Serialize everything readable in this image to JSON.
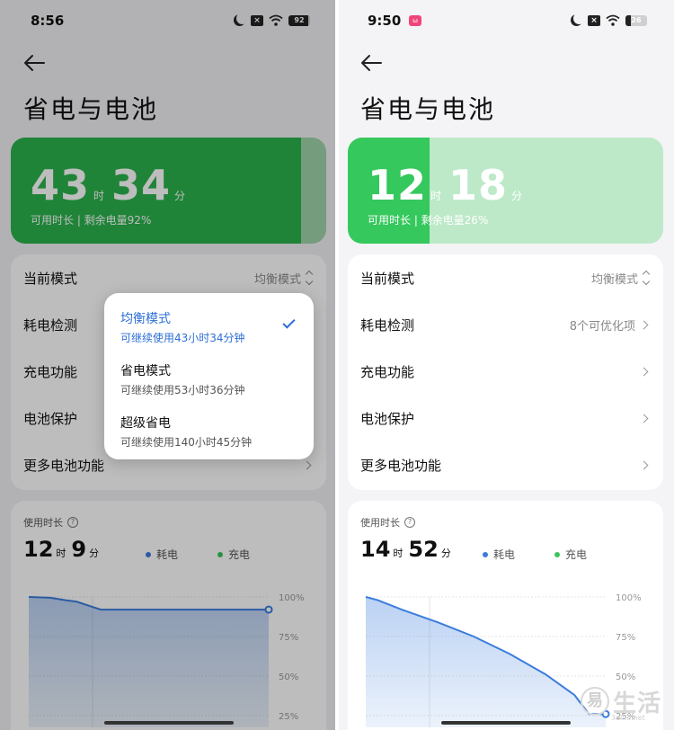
{
  "left": {
    "status": {
      "time": "8:56",
      "battery": "92",
      "battery_level": 0.92
    },
    "title": "省电与电池",
    "battery_card": {
      "hours": "43",
      "hour_unit": "时",
      "minutes": "34",
      "minute_unit": "分",
      "subtitle": "可用时长 | 剩余电量92%",
      "level": 0.92,
      "fill_color": "#2bb24c",
      "rest_color": "#9ed3a8"
    },
    "rows": [
      {
        "label": "当前模式",
        "value": "均衡模式"
      },
      {
        "label": "耗电检测",
        "value": ""
      },
      {
        "label": "充电功能",
        "value": ""
      },
      {
        "label": "电池保护",
        "value": ""
      },
      {
        "label": "更多电池功能",
        "value": ""
      }
    ],
    "usage": {
      "title": "使用时长",
      "hours": "12",
      "hour_unit": "时",
      "minutes": "9",
      "minute_unit": "分",
      "legend_drain": "耗电",
      "legend_charge": "充电"
    },
    "popup": {
      "options": [
        {
          "name": "均衡模式",
          "desc": "可继续使用43小时34分钟",
          "selected": true
        },
        {
          "name": "省电模式",
          "desc": "可继续使用53小时36分钟",
          "selected": false
        },
        {
          "name": "超级省电",
          "desc": "可继续使用140小时45分钟",
          "selected": false
        }
      ]
    }
  },
  "right": {
    "status": {
      "time": "9:50",
      "battery": "26",
      "battery_level": 0.26
    },
    "title": "省电与电池",
    "battery_card": {
      "hours": "12",
      "hour_unit": "时",
      "minutes": "18",
      "minute_unit": "分",
      "subtitle": "可用时长 | 剩余电量26%",
      "level": 0.26,
      "fill_color": "#35c85c",
      "rest_color": "#bde9c8"
    },
    "rows": [
      {
        "label": "当前模式",
        "value": "均衡模式"
      },
      {
        "label": "耗电检测",
        "value": "8个可优化项"
      },
      {
        "label": "充电功能",
        "value": ""
      },
      {
        "label": "电池保护",
        "value": ""
      },
      {
        "label": "更多电池功能",
        "value": ""
      }
    ],
    "usage": {
      "title": "使用时长",
      "hours": "14",
      "hour_unit": "时",
      "minutes": "52",
      "minute_unit": "分",
      "legend_drain": "耗电",
      "legend_charge": "充电"
    }
  },
  "colors": {
    "drain": "#3b7ddd",
    "charge": "#3cc45a",
    "accent": "#2d6fd6"
  },
  "chart_data": [
    {
      "type": "area",
      "y_ticks": [
        "100%",
        "75%",
        "50%",
        "25%"
      ],
      "ylim": [
        25,
        100
      ],
      "x": [
        0,
        0.09,
        0.15,
        0.2,
        0.26,
        0.3,
        0.45,
        0.6,
        1.0
      ],
      "values": [
        100,
        99.5,
        98,
        97,
        94,
        92,
        92,
        92,
        92
      ],
      "color": "#3b7ddd",
      "xlabel": "",
      "ylabel": "",
      "title": ""
    },
    {
      "type": "area",
      "y_ticks": [
        "100%",
        "75%",
        "50%",
        "25%"
      ],
      "ylim": [
        25,
        100
      ],
      "x": [
        0,
        0.05,
        0.15,
        0.3,
        0.45,
        0.6,
        0.75,
        0.87,
        0.93,
        1.0
      ],
      "values": [
        100,
        98,
        92,
        84,
        75,
        64,
        51,
        38,
        26,
        26
      ],
      "color": "#3b7ddd",
      "xlabel": "",
      "ylabel": "",
      "title": ""
    }
  ],
  "watermark": {
    "glyph": "易",
    "text": "生活",
    "url": "3elife.net"
  }
}
